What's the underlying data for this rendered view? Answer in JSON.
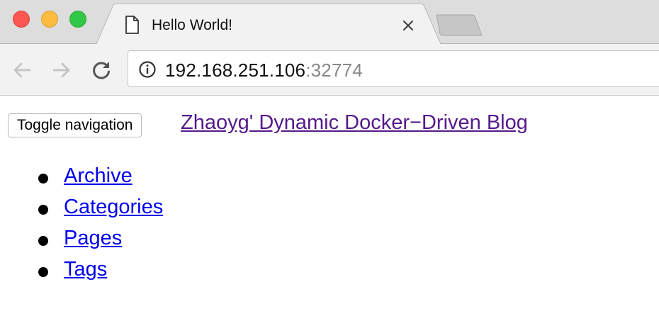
{
  "window": {
    "controls": [
      "close",
      "minimize",
      "maximize"
    ]
  },
  "tab": {
    "title": "Hello World!",
    "icon": "page-icon",
    "close_icon": "close-icon"
  },
  "toolbar": {
    "back_icon": "back-arrow-icon",
    "forward_icon": "forward-arrow-icon",
    "reload_icon": "reload-icon",
    "info_icon": "info-icon"
  },
  "address_bar": {
    "host": "192.168.251.106",
    "port": ":32774"
  },
  "navbar": {
    "toggle_label": "Toggle navigation",
    "brand": "Zhaoyg' Dynamic Docker−Driven Blog"
  },
  "nav": {
    "items": [
      {
        "label": "Archive"
      },
      {
        "label": "Categories"
      },
      {
        "label": "Pages"
      },
      {
        "label": "Tags"
      }
    ]
  },
  "colors": {
    "visited_link": "#551a8b",
    "link": "#0000ee",
    "tabstrip_bg": "#dddddd",
    "toolbar_bg": "#f2f2f2",
    "close_button": "#fc5753",
    "minimize_button": "#fdbc40",
    "maximize_button": "#33c748"
  }
}
